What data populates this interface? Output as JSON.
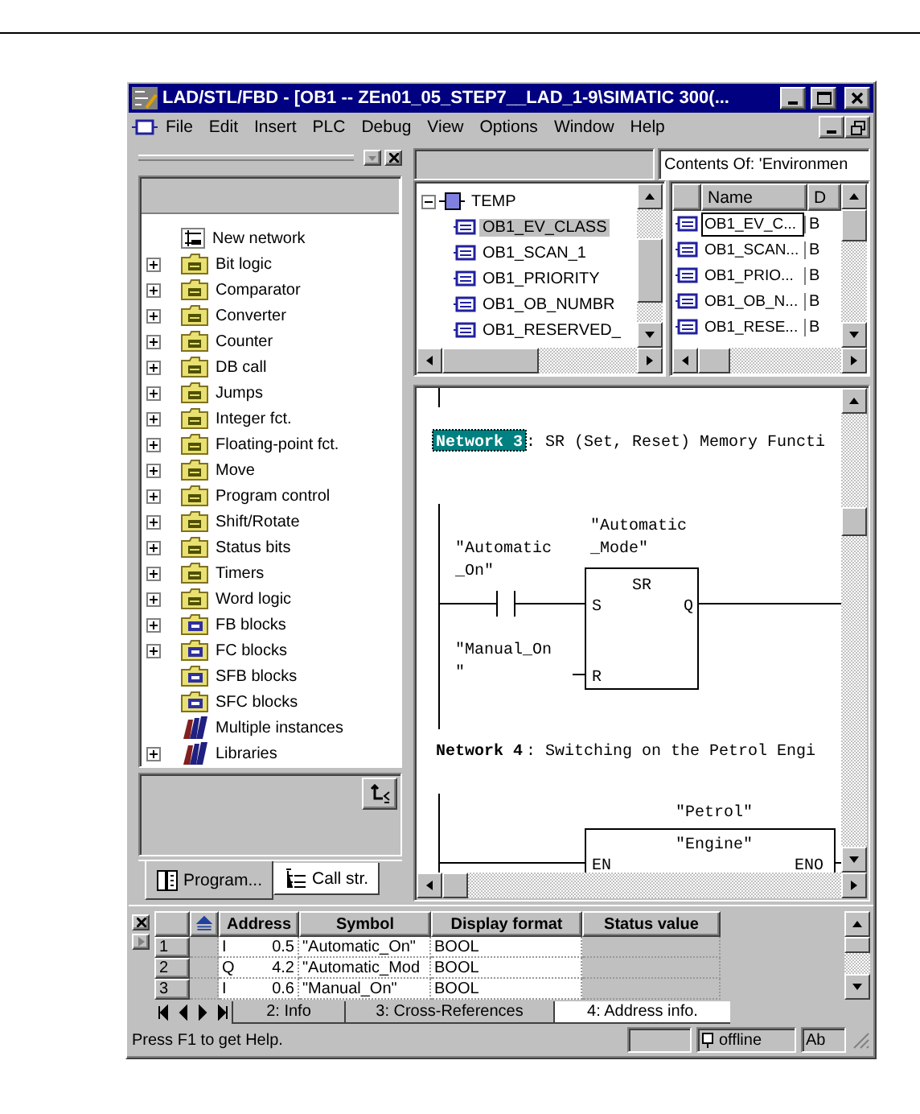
{
  "window": {
    "title": "LAD/STL/FBD  - [OB1 -- ZEn01_05_STEP7__LAD_1-9\\SIMATIC 300(..."
  },
  "menu": [
    "File",
    "Edit",
    "Insert",
    "PLC",
    "Debug",
    "View",
    "Options",
    "Window",
    "Help"
  ],
  "catalog": {
    "items": [
      {
        "label": "New network",
        "kind": "network",
        "expandable": false
      },
      {
        "label": "Bit logic",
        "kind": "folder",
        "expandable": true
      },
      {
        "label": "Comparator",
        "kind": "folder",
        "expandable": true
      },
      {
        "label": "Converter",
        "kind": "folder",
        "expandable": true
      },
      {
        "label": "Counter",
        "kind": "folder",
        "expandable": true
      },
      {
        "label": "DB call",
        "kind": "folder",
        "expandable": true
      },
      {
        "label": "Jumps",
        "kind": "folder",
        "expandable": true
      },
      {
        "label": "Integer fct.",
        "kind": "folder",
        "expandable": true
      },
      {
        "label": "Floating-point fct.",
        "kind": "folder",
        "expandable": true
      },
      {
        "label": "Move",
        "kind": "folder",
        "expandable": true
      },
      {
        "label": "Program control",
        "kind": "folder",
        "expandable": true
      },
      {
        "label": "Shift/Rotate",
        "kind": "folder",
        "expandable": true
      },
      {
        "label": "Status bits",
        "kind": "folder",
        "expandable": true
      },
      {
        "label": "Timers",
        "kind": "folder",
        "expandable": true
      },
      {
        "label": "Word logic",
        "kind": "folder",
        "expandable": true
      },
      {
        "label": "FB blocks",
        "kind": "block",
        "expandable": true
      },
      {
        "label": "FC blocks",
        "kind": "block",
        "expandable": true
      },
      {
        "label": "SFB blocks",
        "kind": "block",
        "expandable": false
      },
      {
        "label": "SFC blocks",
        "kind": "block",
        "expandable": false
      },
      {
        "label": "Multiple instances",
        "kind": "library",
        "expandable": false
      },
      {
        "label": "Libraries",
        "kind": "library",
        "expandable": true
      }
    ],
    "tabs": [
      {
        "label": "Program...",
        "selected": true
      },
      {
        "label": "Call str.",
        "selected": false
      }
    ]
  },
  "interface": {
    "root": {
      "label": "TEMP",
      "expanded": true,
      "children": [
        {
          "label": "OB1_EV_CLASS",
          "selected": true
        },
        {
          "label": "OB1_SCAN_1",
          "selected": false
        },
        {
          "label": "OB1_PRIORITY",
          "selected": false
        },
        {
          "label": "OB1_OB_NUMBR",
          "selected": false
        },
        {
          "label": "OB1_RESERVED_",
          "selected": false
        }
      ]
    }
  },
  "contents": {
    "title": "Contents Of: 'Environmen",
    "columns": [
      "Name",
      "D"
    ],
    "rows": [
      {
        "name": "OB1_EV_C...",
        "type": "B",
        "selected": true
      },
      {
        "name": "OB1_SCAN...",
        "type": "B",
        "selected": false
      },
      {
        "name": "OB1_PRIO...",
        "type": "B",
        "selected": false
      },
      {
        "name": "OB1_OB_N...",
        "type": "B",
        "selected": false
      },
      {
        "name": "OB1_RESE...",
        "type": "B",
        "selected": false
      }
    ]
  },
  "editor": {
    "networks": [
      {
        "title": "Network 3",
        "selected": true,
        "comment": ": SR (Set, Reset) Memory Functi",
        "block": {
          "kind": "sr",
          "type": "SR",
          "instance": [
            "\"Automatic",
            "_Mode\""
          ],
          "inputs": [
            {
              "pin": "S",
              "operand": [
                "\"Automatic",
                "_On\""
              ]
            },
            {
              "pin": "R",
              "operand": [
                "\"Manual_On",
                "\""
              ]
            }
          ],
          "outputs": [
            "Q"
          ]
        }
      },
      {
        "title": "Network 4",
        "selected": false,
        "comment": " : Switching on the Petrol Engi",
        "block": {
          "kind": "call",
          "instance": [
            "\"Petrol\""
          ],
          "name": "\"Engine\"",
          "inputs": [
            {
              "pin": "EN"
            }
          ],
          "outputs": [
            "ENO"
          ]
        }
      }
    ]
  },
  "details": {
    "columns": [
      "Address",
      "Symbol",
      "Display format",
      "Status value"
    ],
    "rows": [
      {
        "number": "1",
        "operand": "I",
        "address": "0.5",
        "symbol": "\"Automatic_On\"",
        "format": "BOOL"
      },
      {
        "number": "2",
        "operand": "Q",
        "address": "4.2",
        "symbol": "\"Automatic_Mod",
        "format": "BOOL"
      },
      {
        "number": "3",
        "operand": "I",
        "address": "0.6",
        "symbol": "\"Manual_On\"",
        "format": "BOOL"
      }
    ],
    "tabs": [
      {
        "label": "2: Info",
        "selected": false
      },
      {
        "label": "3: Cross-References",
        "selected": false
      },
      {
        "label": "4: Address info.",
        "selected": true
      }
    ]
  },
  "status_bar": {
    "message": "Press F1 to get Help.",
    "mode": "offline",
    "field": "Ab"
  }
}
